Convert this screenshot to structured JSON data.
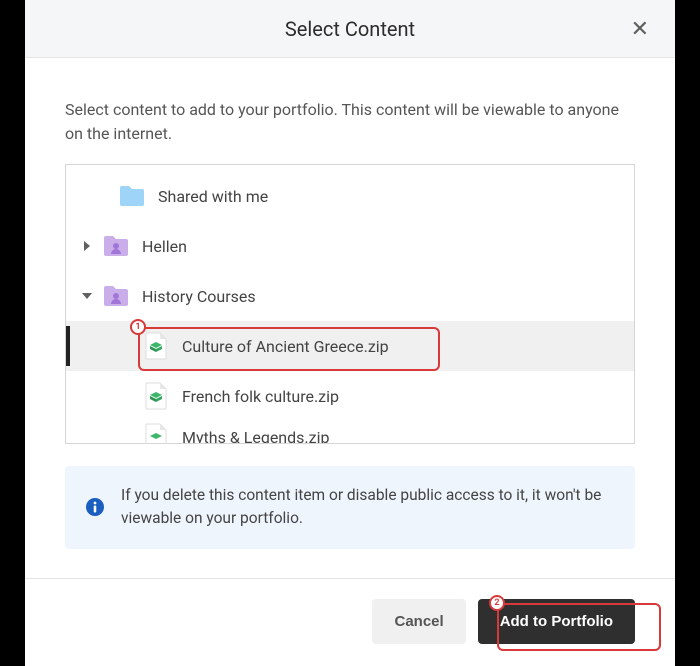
{
  "dialog": {
    "title": "Select Content",
    "description": "Select content to add to your portfolio. This content will be viewable to anyone on the internet."
  },
  "tree": {
    "rows": [
      {
        "label": "Shared with me"
      },
      {
        "label": "Hellen"
      },
      {
        "label": "History Courses"
      },
      {
        "label": "Culture of Ancient Greece.zip"
      },
      {
        "label": "French folk culture.zip"
      },
      {
        "label": "Myths & Legends.zip"
      }
    ]
  },
  "info": {
    "text": "If you delete this content item or disable public access to it, it won't be viewable on your portfolio."
  },
  "footer": {
    "cancel": "Cancel",
    "submit": "Add to Portfolio"
  },
  "callouts": {
    "one": "1",
    "two": "2"
  }
}
